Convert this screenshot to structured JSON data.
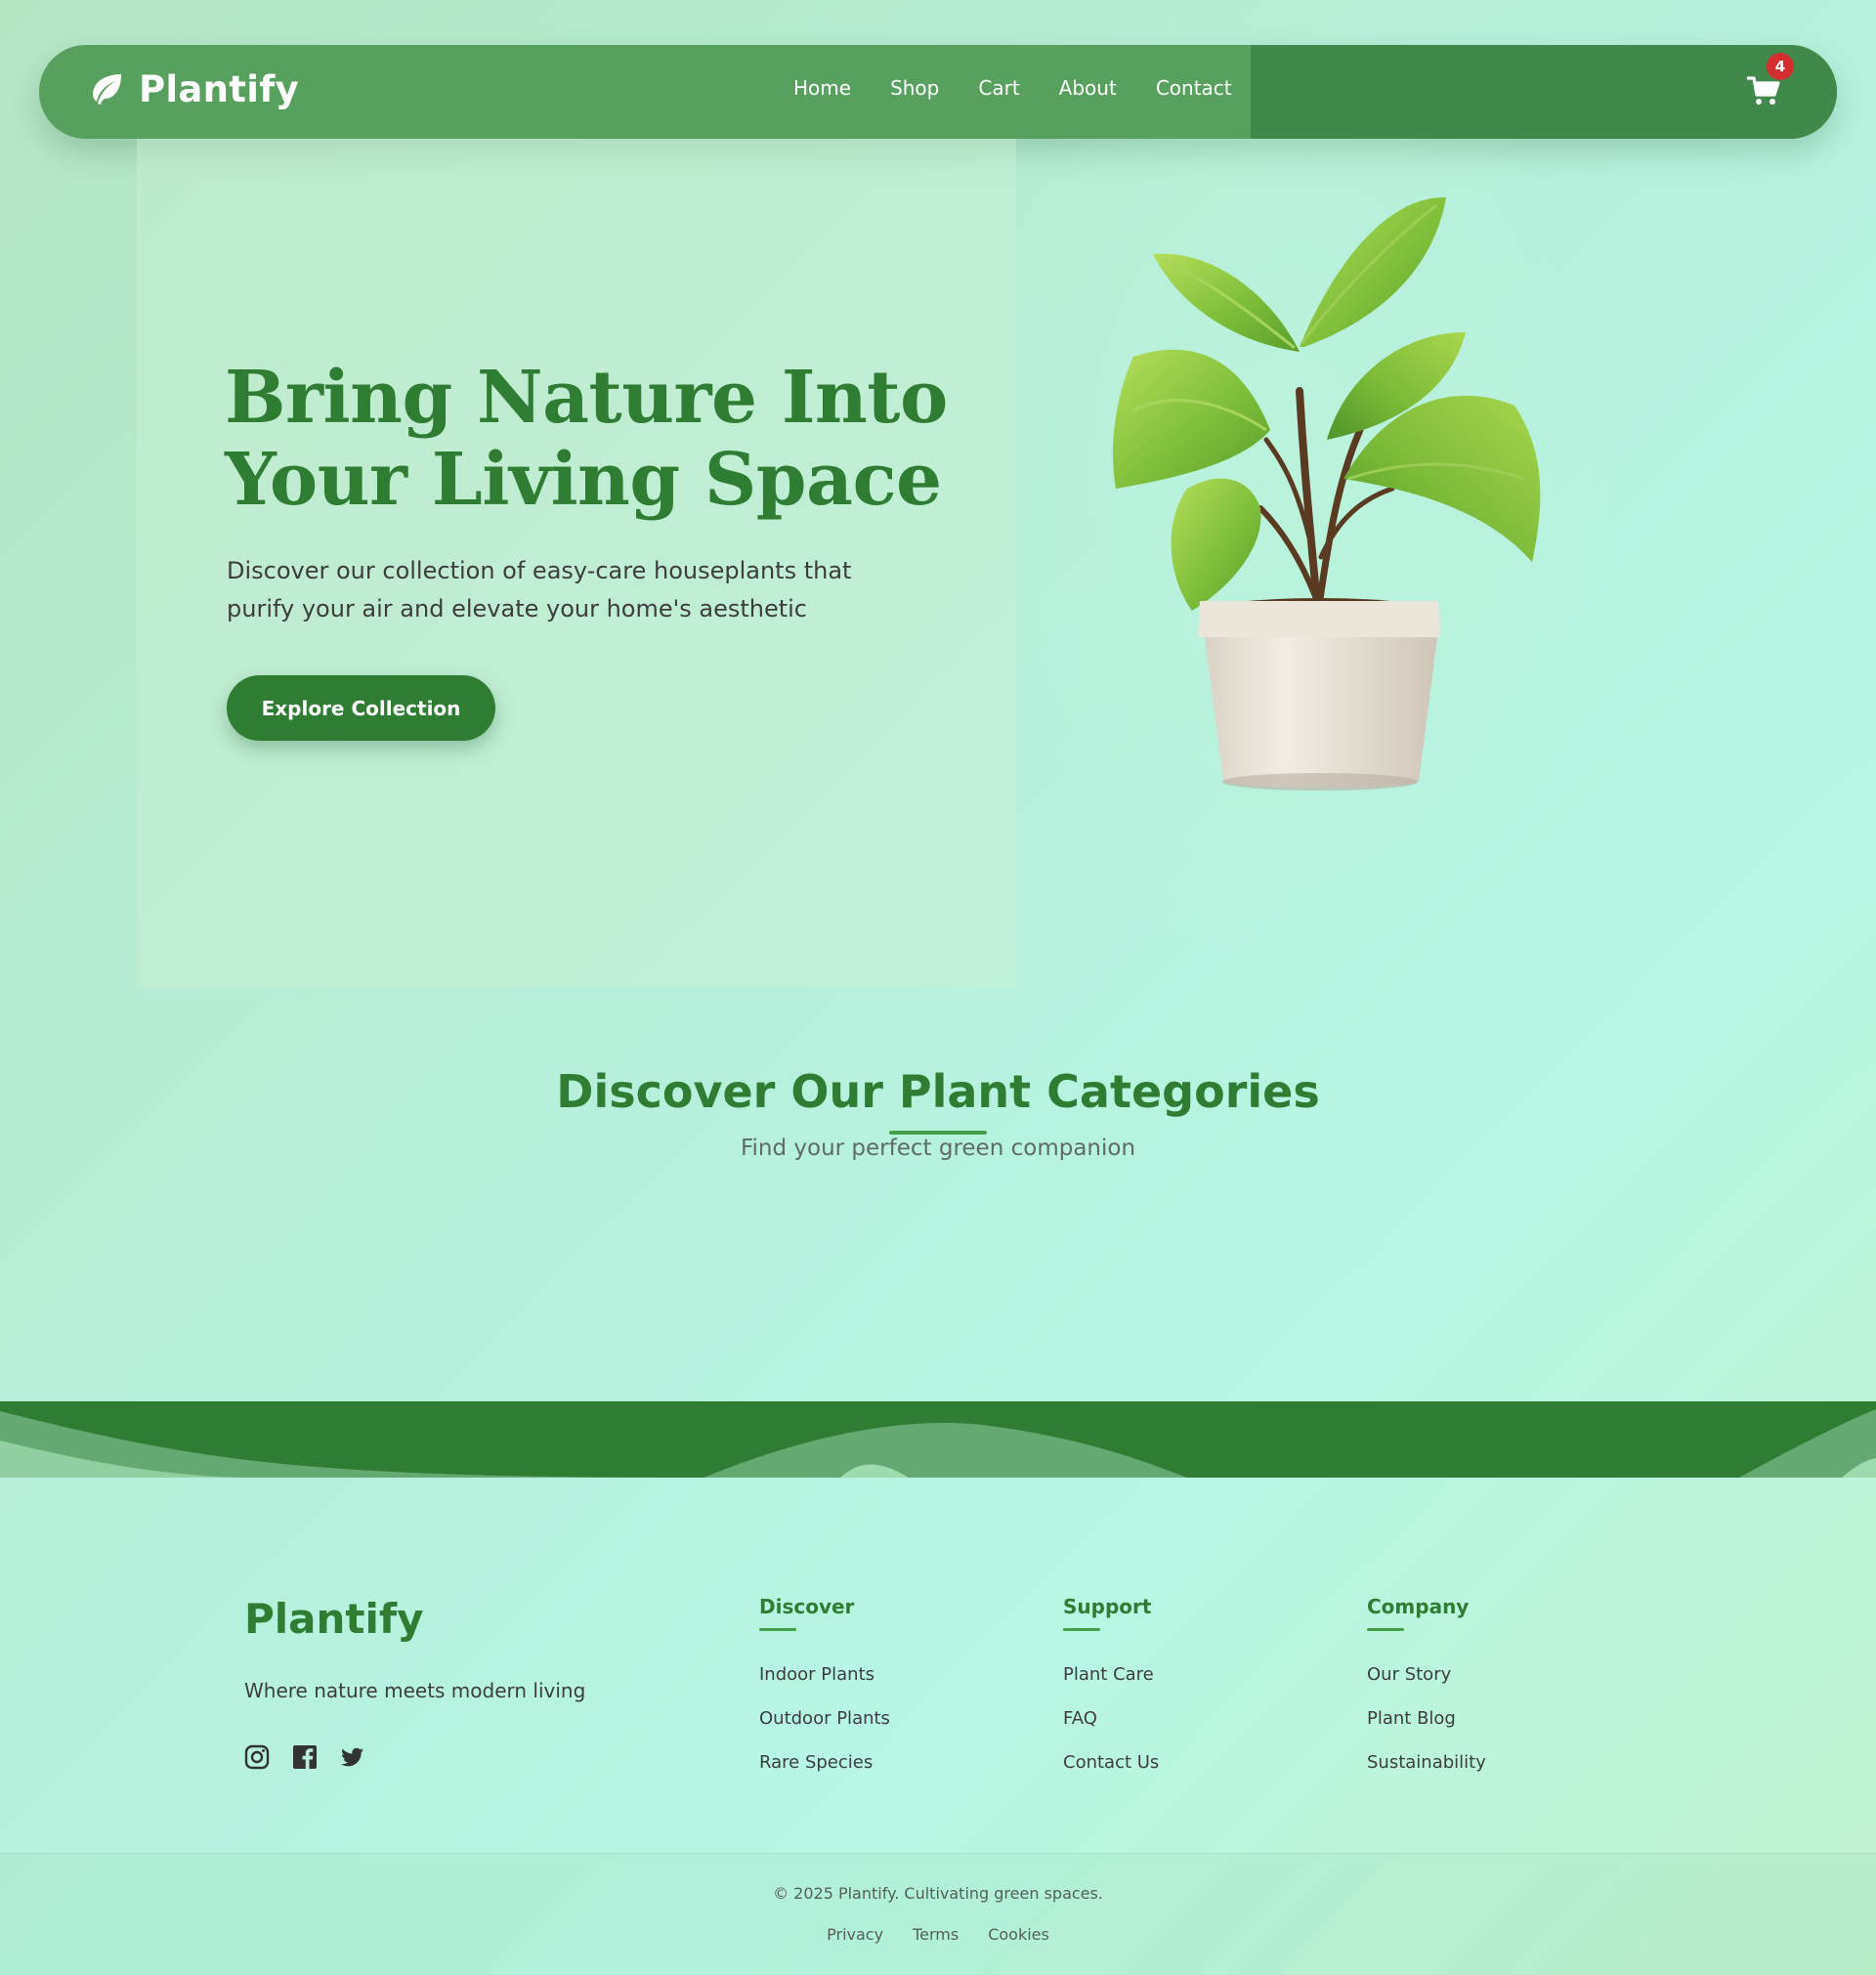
{
  "colors": {
    "primary": "#2e7d32",
    "nav_left": "#57a05e",
    "nav_right": "#41894a",
    "badge": "#d32f2f",
    "accent_line": "#43a047"
  },
  "navbar": {
    "brand": "Plantify",
    "brand_icon": "leaf-icon",
    "links": [
      "Home",
      "Shop",
      "Cart",
      "About",
      "Contact"
    ],
    "cart_icon": "shopping-cart-icon",
    "cart_count": "4"
  },
  "hero": {
    "title_line1": "Bring Nature Into",
    "title_line2": "Your Living Space",
    "subtitle": "Discover our collection of easy-care houseplants that purify your air and elevate your home's aesthetic",
    "cta": "Explore Collection",
    "image": "potted-plant-illustration"
  },
  "categories": {
    "title": "Discover Our Plant Categories",
    "subtitle": "Find your perfect green companion"
  },
  "footer": {
    "brand": "Plantify",
    "tagline": "Where nature meets modern living",
    "socials": [
      "instagram-icon",
      "facebook-icon",
      "twitter-icon"
    ],
    "columns": [
      {
        "title": "Discover",
        "links": [
          "Indoor Plants",
          "Outdoor Plants",
          "Rare Species"
        ]
      },
      {
        "title": "Support",
        "links": [
          "Plant Care",
          "FAQ",
          "Contact Us"
        ]
      },
      {
        "title": "Company",
        "links": [
          "Our Story",
          "Plant Blog",
          "Sustainability"
        ]
      }
    ],
    "copyright": "© 2025 Plantify. Cultivating green spaces.",
    "legal": [
      "Privacy",
      "Terms",
      "Cookies"
    ]
  }
}
